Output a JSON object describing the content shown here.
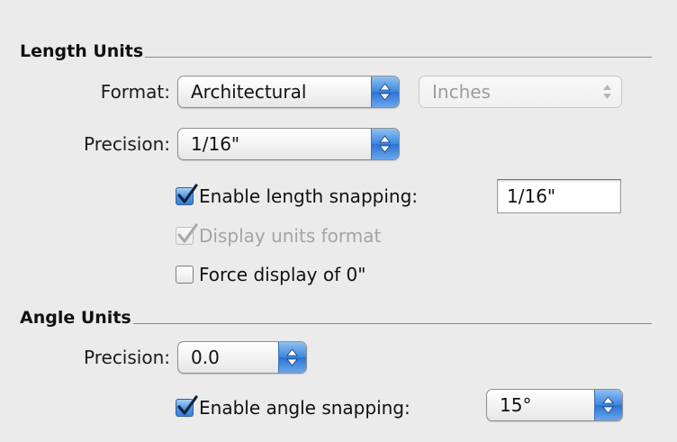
{
  "length_units": {
    "title": "Length Units",
    "format_label": "Format:",
    "format_value": "Architectural",
    "unit_value": "Inches",
    "precision_label": "Precision:",
    "precision_value": "1/16\"",
    "enable_snapping_label": "Enable length snapping:",
    "enable_snapping_checked": true,
    "snapping_value": "1/16\"",
    "display_units_label": "Display units format",
    "display_units_checked": true,
    "display_units_enabled": false,
    "force_zero_label": "Force display of 0\"",
    "force_zero_checked": false
  },
  "angle_units": {
    "title": "Angle Units",
    "precision_label": "Precision:",
    "precision_value": "0.0",
    "enable_snapping_label": "Enable angle snapping:",
    "enable_snapping_checked": true,
    "snapping_value": "15°"
  },
  "icons": {
    "popup_arrows": "up-down-arrows-icon",
    "checkmark": "checkmark-icon"
  },
  "colors": {
    "accent_blue": "#3b86e0",
    "panel_background": "#ebebeb",
    "disabled_text": "#a4a4a4"
  }
}
